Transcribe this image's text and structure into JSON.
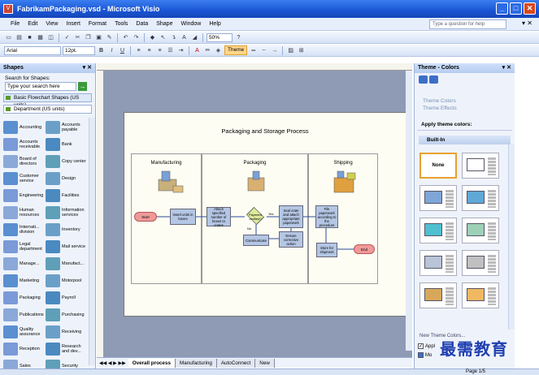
{
  "window": {
    "title": "FabrikamPackaging.vsd - Microsoft Visio"
  },
  "menu": {
    "items": [
      "File",
      "Edit",
      "View",
      "Insert",
      "Format",
      "Tools",
      "Data",
      "Shape",
      "Window",
      "Help"
    ],
    "help_placeholder": "Type a question for help"
  },
  "toolbar": {
    "zoom": "50%",
    "font": "Arial",
    "font_size": "12pt.",
    "theme_label": "Theme"
  },
  "shapes_panel": {
    "title": "Shapes",
    "search_label": "Search for Shapes:",
    "search_placeholder": "Type your search here",
    "stencils": [
      "Basic Flowchart Shapes (US units)",
      "Department (US units)"
    ],
    "items": [
      "Accounting",
      "Accounts payable",
      "Accounts receivable",
      "Bank",
      "Board of directors",
      "Copy center",
      "Customer service",
      "Design",
      "Engineering",
      "Facilities",
      "Human resources",
      "Information services",
      "Internati... division",
      "Inventory",
      "Legal department",
      "Mail service",
      "Manage...",
      "Manufact...",
      "Marketing",
      "Motorpool",
      "Packaging",
      "Payroll",
      "Publications",
      "Purchasing",
      "Quality assurance",
      "Receiving",
      "Reception",
      "Research and dev...",
      "Sales",
      "Security"
    ]
  },
  "diagram": {
    "title": "Packaging and Storage Process",
    "lanes": [
      "Manufacturing",
      "Packaging",
      "Shipping"
    ],
    "start": "Start",
    "end": "End",
    "steps": {
      "s1": "Insert units in boxes",
      "s2": "Attach specified number of boxes to crates",
      "d1": "Payment verified?",
      "s3": "Seal crate and attach appropriate paperwork",
      "s4": "File paperwork according to the procedure",
      "s5": "Communicate",
      "s6": "Ensure corrective action",
      "s7": "Store for shipment",
      "yes": "Yes",
      "no": "No"
    }
  },
  "page_tabs": [
    "Overall process",
    "Manufacturing",
    "AutoConnect",
    "New"
  ],
  "theme_panel": {
    "title": "Theme - Colors",
    "links": [
      "Theme Colors",
      "Theme Effects"
    ],
    "apply_title": "Apply theme colors:",
    "builtin_label": "Built-In",
    "none_label": "None",
    "new_theme": "New Theme Colors...",
    "apply_check": "Appl",
    "more": "Mo"
  },
  "theme_swatches": [
    "#7fa6d8",
    "#5fa8d8",
    "#4fc0d0",
    "#9ed0b8",
    "#b8c4d8",
    "#c0c0c0",
    "#d8a85a",
    "#f0b860"
  ],
  "status": {
    "page": "Page 1/5"
  },
  "watermark": "最需教育"
}
